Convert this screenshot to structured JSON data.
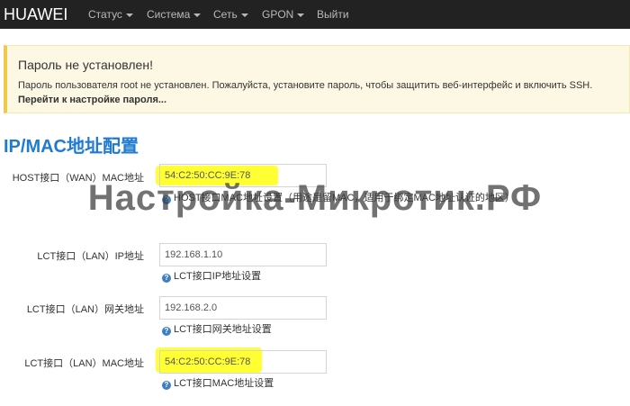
{
  "navbar": {
    "brand": "HUAWEI",
    "items": [
      "Статус",
      "Система",
      "Сеть",
      "GPON",
      "Выйти"
    ]
  },
  "alert": {
    "title": "Пароль не установлен!",
    "text": "Пароль пользователя root не установлен. Пожалуйста, установите пароль, чтобы защитить веб-интерфейс и включить SSH.",
    "link": "Перейти к настройке пароля..."
  },
  "page": {
    "title": "IP/MAC地址配置"
  },
  "fields": [
    {
      "label": "HOST接口（WAN）MAC地址",
      "value": "54:C2:50:CC:9E:78",
      "help": "HOST接口MAC地址设置（用途是留MAC，适用于绑定MAC地址认证的地区）"
    },
    {
      "label": "LCT接口（LAN）IP地址",
      "value": "192.168.1.10",
      "help": "LCT接口IP地址设置"
    },
    {
      "label": "LCT接口（LAN）网关地址",
      "value": "192.168.2.0",
      "help": "LCT接口网关地址设置"
    },
    {
      "label": "LCT接口（LAN）MAC地址",
      "value": "54:C2:50:CC:9E:78",
      "help": "LCT接口MAC地址设置"
    }
  ],
  "watermark": "Настройка-Микротик.РФ",
  "colors": {
    "highlight": "#ffff33",
    "title": "#1f7ad1",
    "navbar": "#222222",
    "alert_bg": "#fcf8e3"
  }
}
